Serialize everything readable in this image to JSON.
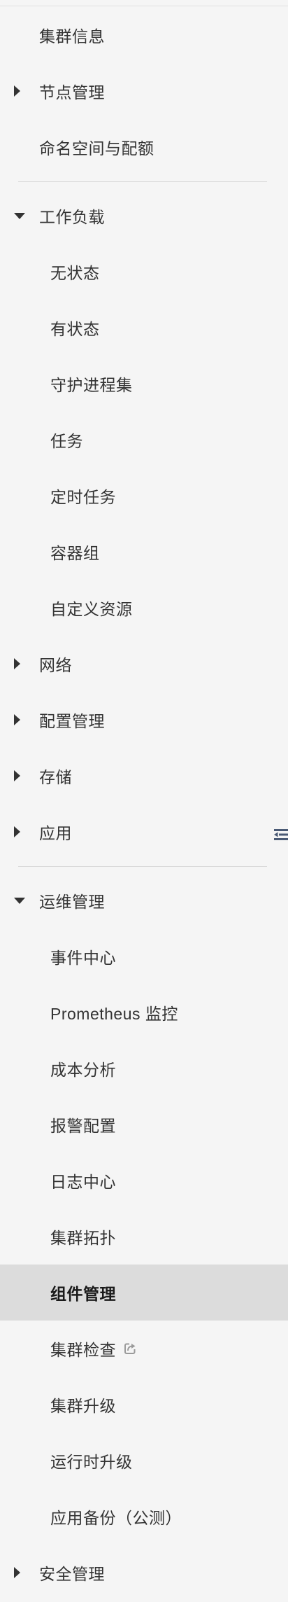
{
  "sidebar": {
    "cluster_info": "集群信息",
    "node_mgmt": "节点管理",
    "namespace_quota": "命名空间与配额",
    "workloads": {
      "label": "工作负载",
      "items": [
        "无状态",
        "有状态",
        "守护进程集",
        "任务",
        "定时任务",
        "容器组",
        "自定义资源"
      ]
    },
    "network": "网络",
    "config_mgmt": "配置管理",
    "storage": "存储",
    "apps": "应用",
    "ops": {
      "label": "运维管理",
      "items": [
        "事件中心",
        "Prometheus 监控",
        "成本分析",
        "报警配置",
        "日志中心",
        "集群拓扑",
        "组件管理",
        "集群检查",
        "集群升级",
        "运行时升级",
        "应用备份（公测）"
      ],
      "active": "组件管理",
      "external_link_item": "集群检查"
    },
    "security": "安全管理"
  },
  "colors": {
    "background": "#f5f5f5",
    "active_background": "#dcdcdc",
    "text": "#333333",
    "divider": "#d9d9d9",
    "handle_icon": "#4a5a75"
  },
  "icons": {
    "collapsed": "caret-right-icon",
    "expanded": "caret-down-icon",
    "external": "external-link-icon",
    "collapse_sidebar": "collapse-sidebar-icon"
  }
}
